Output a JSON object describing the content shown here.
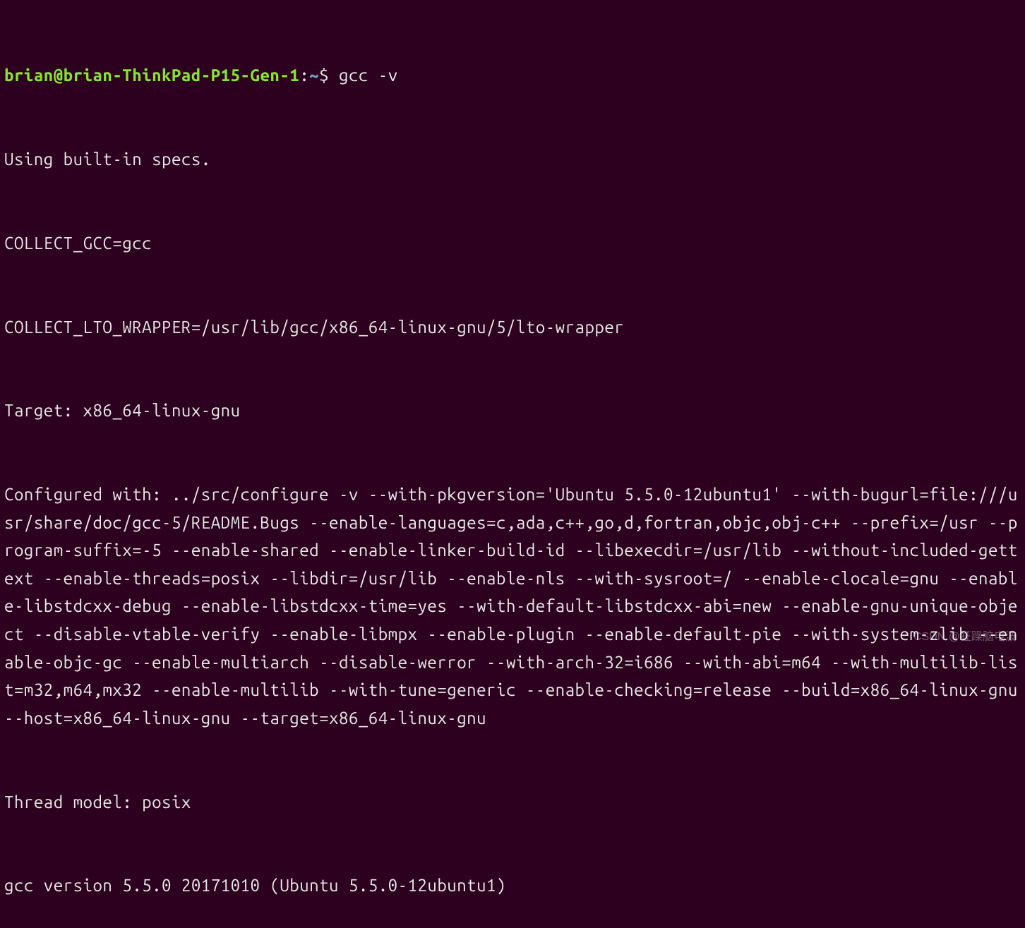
{
  "prompt": {
    "user_host": "brian@brian-ThinkPad-P15-Gen-1",
    "separator": ":",
    "path": "~",
    "symbol": "$",
    "command": "gcc -v"
  },
  "output": {
    "lines": [
      "Using built-in specs.",
      "COLLECT_GCC=gcc",
      "COLLECT_LTO_WRAPPER=/usr/lib/gcc/x86_64-linux-gnu/5/lto-wrapper",
      "Target: x86_64-linux-gnu",
      "Configured with: ../src/configure -v --with-pkgversion='Ubuntu 5.5.0-12ubuntu1' --with-bugurl=file:///usr/share/doc/gcc-5/README.Bugs --enable-languages=c,ada,c++,go,d,fortran,objc,obj-c++ --prefix=/usr --program-suffix=-5 --enable-shared --enable-linker-build-id --libexecdir=/usr/lib --without-included-gettext --enable-threads=posix --libdir=/usr/lib --enable-nls --with-sysroot=/ --enable-clocale=gnu --enable-libstdcxx-debug --enable-libstdcxx-time=yes --with-default-libstdcxx-abi=new --enable-gnu-unique-object --disable-vtable-verify --enable-libmpx --enable-plugin --enable-default-pie --with-system-zlib --enable-objc-gc --enable-multiarch --disable-werror --with-arch-32=i686 --with-abi=m64 --with-multilib-list=m32,m64,mx32 --enable-multilib --with-tune=generic --enable-checking=release --build=x86_64-linux-gnu --host=x86_64-linux-gnu --target=x86_64-linux-gnu",
      "Thread model: posix",
      "gcc version 5.5.0 20171010 (Ubuntu 5.5.0-12ubuntu1)"
    ]
  },
  "watermark": "CSDN @狂躁脑电波"
}
